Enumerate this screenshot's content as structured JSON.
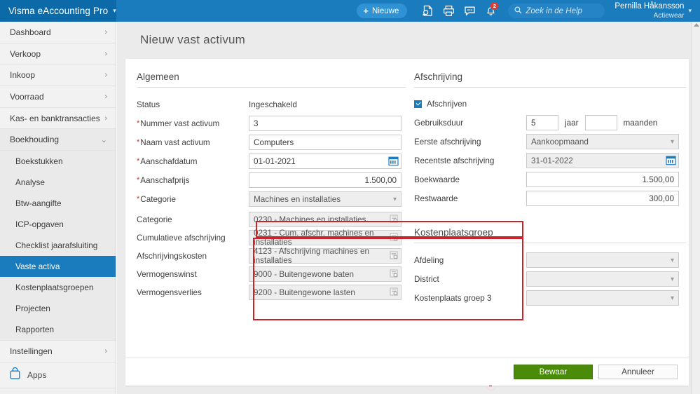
{
  "topbar": {
    "brand": "Visma eAccounting Pro",
    "brand_caret_icon": "chevron-down-icon",
    "new_button": "Nieuwe",
    "icons": [
      {
        "name": "document-search-icon"
      },
      {
        "name": "printer-icon"
      },
      {
        "name": "chat-icon"
      },
      {
        "name": "bell-icon",
        "badge": "2"
      }
    ],
    "help_search_placeholder": "Zoek in de Help",
    "user_name": "Pernilla Håkansson",
    "user_company": "Actiewear"
  },
  "sidebar": {
    "items": [
      {
        "label": "Dashboard",
        "chevron": "›",
        "expanded": false
      },
      {
        "label": "Verkoop",
        "chevron": "›",
        "expanded": false
      },
      {
        "label": "Inkoop",
        "chevron": "›",
        "expanded": false
      },
      {
        "label": "Voorraad",
        "chevron": "›",
        "expanded": false
      },
      {
        "label": "Kas- en banktransacties",
        "chevron": "›",
        "expanded": false
      },
      {
        "label": "Boekhouding",
        "chevron": "⌄",
        "expanded": true
      }
    ],
    "sub_items": [
      {
        "label": "Boekstukken",
        "active": false
      },
      {
        "label": "Analyse",
        "active": false
      },
      {
        "label": "Btw-aangifte",
        "active": false
      },
      {
        "label": "ICP-opgaven",
        "active": false
      },
      {
        "label": "Checklist jaarafsluiting",
        "active": false
      },
      {
        "label": "Vaste activa",
        "active": true
      },
      {
        "label": "Kostenplaatsgroepen",
        "active": false
      },
      {
        "label": "Projecten",
        "active": false
      },
      {
        "label": "Rapporten",
        "active": false
      }
    ],
    "settings": {
      "label": "Instellingen",
      "chevron": "›"
    },
    "apps": {
      "label": "Apps",
      "icon": "apps-bag-icon"
    }
  },
  "page": {
    "title": "Nieuw vast activum"
  },
  "general": {
    "title": "Algemeen",
    "status_label": "Status",
    "status_value": "Ingeschakeld",
    "number_label": "Nummer vast activum",
    "number_value": "3",
    "name_label": "Naam vast activum",
    "name_value": "Computers",
    "purchase_date_label": "Aanschafdatum",
    "purchase_date_value": "01-01-2021",
    "purchase_price_label": "Aanschafprijs",
    "purchase_price_value": "1.500,00",
    "category_label": "Categorie",
    "category_value": "Machines en installaties"
  },
  "accounts": {
    "rows": [
      {
        "label": "Categorie",
        "value": "0230 - Machines en installaties"
      },
      {
        "label": "Cumulatieve afschrijving",
        "value": "0231 - Cum. afschr. machines en installaties"
      },
      {
        "label": "Afschrijvingskosten",
        "value": "4123 - Afschrijving machines en installaties"
      },
      {
        "label": "Vermogenswinst",
        "value": "9000 - Buitengewone baten"
      },
      {
        "label": "Vermogensverlies",
        "value": "9200 - Buitengewone lasten"
      }
    ]
  },
  "depreciation": {
    "title": "Afschrijving",
    "checkbox_label": "Afschrijven",
    "checkbox_checked": true,
    "lifetime_label": "Gebruiksduur",
    "lifetime_years": "5",
    "lifetime_years_unit": "jaar",
    "lifetime_months": "",
    "lifetime_months_unit": "maanden",
    "first_label": "Eerste afschrijving",
    "first_value": "Aankoopmaand",
    "latest_label": "Recentste afschrijving",
    "latest_value": "31-01-2022",
    "bookvalue_label": "Boekwaarde",
    "bookvalue_value": "1.500,00",
    "residual_label": "Restwaarde",
    "residual_value": "300,00"
  },
  "costcenter": {
    "title": "Kostenplaatsgroep",
    "rows": [
      {
        "label": "Afdeling",
        "value": ""
      },
      {
        "label": "District",
        "value": ""
      },
      {
        "label": "Kostenplaats groep 3",
        "value": ""
      }
    ]
  },
  "footer": {
    "save_label": "Bewaar",
    "cancel_label": "Annuleer"
  },
  "colors": {
    "brand_blue": "#1a7bbd",
    "brand_blue_dark": "#0d6aa8",
    "save_green": "#4a8b09",
    "highlight_red": "#cc2229",
    "badge_red": "#e03b2f"
  }
}
